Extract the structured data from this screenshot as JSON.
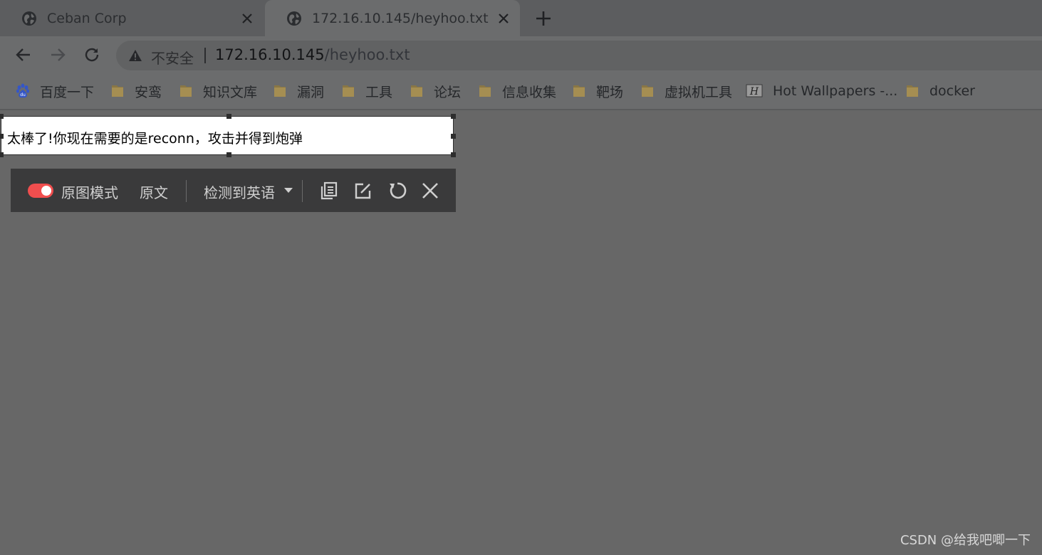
{
  "tabs": [
    {
      "title": "Ceban Corp",
      "active": false
    },
    {
      "title": "172.16.10.145/heyhoo.txt",
      "active": true
    }
  ],
  "address_bar": {
    "security_label": "不安全",
    "url_host": "172.16.10.145",
    "url_path": "/heyhoo.txt"
  },
  "bookmarks": [
    {
      "label": "百度一下",
      "icon": "baidu-paw-icon"
    },
    {
      "label": "安鸾",
      "icon": "folder-icon"
    },
    {
      "label": "知识文库",
      "icon": "folder-icon"
    },
    {
      "label": "漏洞",
      "icon": "folder-icon"
    },
    {
      "label": "工具",
      "icon": "folder-icon"
    },
    {
      "label": "论坛",
      "icon": "folder-icon"
    },
    {
      "label": "信息收集",
      "icon": "folder-icon"
    },
    {
      "label": "靶场",
      "icon": "folder-icon"
    },
    {
      "label": "虚拟机工具",
      "icon": "folder-icon"
    },
    {
      "label": "Hot Wallpapers -...",
      "icon": "site-h-icon"
    },
    {
      "label": "docker",
      "icon": "folder-icon"
    }
  ],
  "selection": {
    "translated_text": "太棒了!你现在需要的是reconn，攻击并得到炮弹"
  },
  "translation_toolbar": {
    "mode_label": "原图模式",
    "mode_on": true,
    "original_label": "原文",
    "language_label": "检测到英语"
  },
  "watermark": "CSDN @给我吧唧一下",
  "colors": {
    "toggle_on": "#f04e4e",
    "toolbar_bg": "#3a3a3b",
    "page_overlay": "#676767"
  }
}
